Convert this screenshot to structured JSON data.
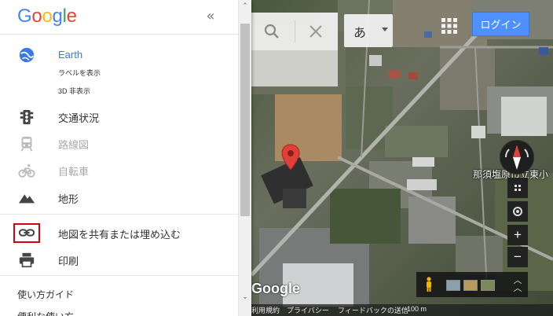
{
  "sidebar": {
    "logo": [
      "G",
      "o",
      "o",
      "g",
      "l",
      "e"
    ],
    "logo_colors": [
      "#4285f4",
      "#ea4335",
      "#fbbc05",
      "#4285f4",
      "#34a853",
      "#ea4335"
    ],
    "collapse_label": "«",
    "earth": {
      "label": "Earth",
      "show_labels": "ラベルを表示",
      "disable_3d": "3D 非表示",
      "accent": "#3b78e7"
    },
    "layers": [
      {
        "label": "交通状況",
        "icon": "traffic-light-icon",
        "enabled": true
      },
      {
        "label": "路線図",
        "icon": "train-icon",
        "enabled": false
      },
      {
        "label": "自転車",
        "icon": "bicycle-icon",
        "enabled": false
      },
      {
        "label": "地形",
        "icon": "terrain-icon",
        "enabled": true
      }
    ],
    "share_label": "地図を共有または埋め込む",
    "print_label": "印刷",
    "guide_label": "使い方ガイド",
    "tips_label": "便利な使い方"
  },
  "map_top": {
    "ime_label": "あ",
    "login_label": "ログイン",
    "login_color": "#4d90fe"
  },
  "map_controls": {
    "zoom_in": "+",
    "zoom_out": "−",
    "expand": "︿\n︿"
  },
  "map_labels": {
    "place": "那須塩原市立東小",
    "watermark": "Google"
  },
  "footer": {
    "terms": "利用規約",
    "privacy": "プライバシー",
    "feedback": "フィードバックの送信",
    "scale": "100 m"
  },
  "highlight_color": "#d7000f"
}
